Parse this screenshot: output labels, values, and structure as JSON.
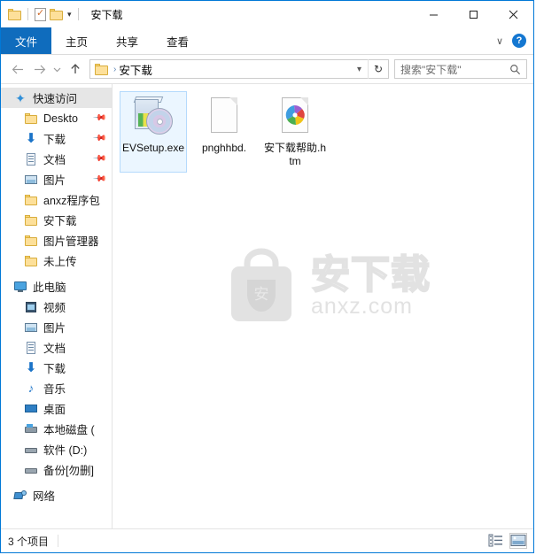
{
  "window": {
    "title": "安下载",
    "quick_access_toolbar": [
      {
        "name": "folder-properties-icon",
        "tooltip": "属性"
      },
      {
        "name": "new-folder-icon",
        "tooltip": "新建文件夹"
      },
      {
        "name": "customize-caret-icon",
        "tooltip": "自定义快速访问工具栏"
      }
    ],
    "controls": {
      "minimize": "最小化",
      "maximize": "最大化",
      "close": "关闭"
    }
  },
  "ribbon": {
    "tabs": [
      {
        "label": "文件",
        "active": true
      },
      {
        "label": "主页",
        "active": false
      },
      {
        "label": "共享",
        "active": false
      },
      {
        "label": "查看",
        "active": false
      }
    ],
    "expand_label": "∨",
    "help_label": "?"
  },
  "address": {
    "back_label": "←",
    "forward_label": "→",
    "recent_label": "∨",
    "up_label": "↑",
    "breadcrumb": [
      {
        "label": "安下载"
      }
    ],
    "separator": "›",
    "dropdown_label": "∨",
    "refresh_label": "↻"
  },
  "search": {
    "placeholder": "搜索\"安下载\"",
    "icon": "search-icon"
  },
  "sidebar": {
    "groups": [
      {
        "name": "quick-access",
        "header": {
          "label": "快速访问",
          "icon": "star-icon",
          "selected": true
        },
        "items": [
          {
            "label": "Deskto",
            "icon": "folder-icon",
            "pinned": true
          },
          {
            "label": "下载",
            "icon": "download-icon",
            "pinned": true
          },
          {
            "label": "文档",
            "icon": "document-icon",
            "pinned": true
          },
          {
            "label": "图片",
            "icon": "picture-icon",
            "pinned": true
          },
          {
            "label": "anxz程序包",
            "icon": "folder-icon",
            "pinned": false
          },
          {
            "label": "安下载",
            "icon": "folder-icon",
            "pinned": false
          },
          {
            "label": "图片管理器",
            "icon": "folder-icon",
            "pinned": false
          },
          {
            "label": "未上传",
            "icon": "folder-icon",
            "pinned": false
          }
        ]
      },
      {
        "name": "this-pc",
        "header": {
          "label": "此电脑",
          "icon": "computer-icon",
          "selected": false
        },
        "items": [
          {
            "label": "视频",
            "icon": "video-icon",
            "pinned": false
          },
          {
            "label": "图片",
            "icon": "picture-icon",
            "pinned": false
          },
          {
            "label": "文档",
            "icon": "document-icon",
            "pinned": false
          },
          {
            "label": "下载",
            "icon": "download-icon",
            "pinned": false
          },
          {
            "label": "音乐",
            "icon": "music-icon",
            "pinned": false
          },
          {
            "label": "桌面",
            "icon": "desktop-icon",
            "pinned": false
          },
          {
            "label": "本地磁盘 (",
            "icon": "local-disk-icon",
            "pinned": false
          },
          {
            "label": "软件 (D:)",
            "icon": "drive-icon",
            "pinned": false
          },
          {
            "label": "备份[勿删]",
            "icon": "drive-icon",
            "pinned": false
          }
        ]
      },
      {
        "name": "network",
        "header": {
          "label": "网络",
          "icon": "network-icon",
          "selected": false
        },
        "items": []
      }
    ]
  },
  "files": [
    {
      "name": "EVSetup.exe",
      "icon": "installer-icon",
      "selected": true
    },
    {
      "name": "pnghhbd.",
      "icon": "blank-document-icon",
      "selected": false
    },
    {
      "name": "安下载帮助.htm",
      "icon": "html-document-icon",
      "selected": false
    }
  ],
  "watermark": {
    "logo_text": "安",
    "title": "安下载",
    "domain": "anxz.com"
  },
  "statusbar": {
    "item_count": "3 个项目",
    "views": [
      {
        "name": "details-view-button",
        "active": false
      },
      {
        "name": "large-icons-view-button",
        "active": true
      }
    ]
  },
  "colors": {
    "accent": "#0f6cbd",
    "window_border": "#0078d7",
    "selection": "#cce8ff",
    "watermark": "#e2e2e2"
  }
}
